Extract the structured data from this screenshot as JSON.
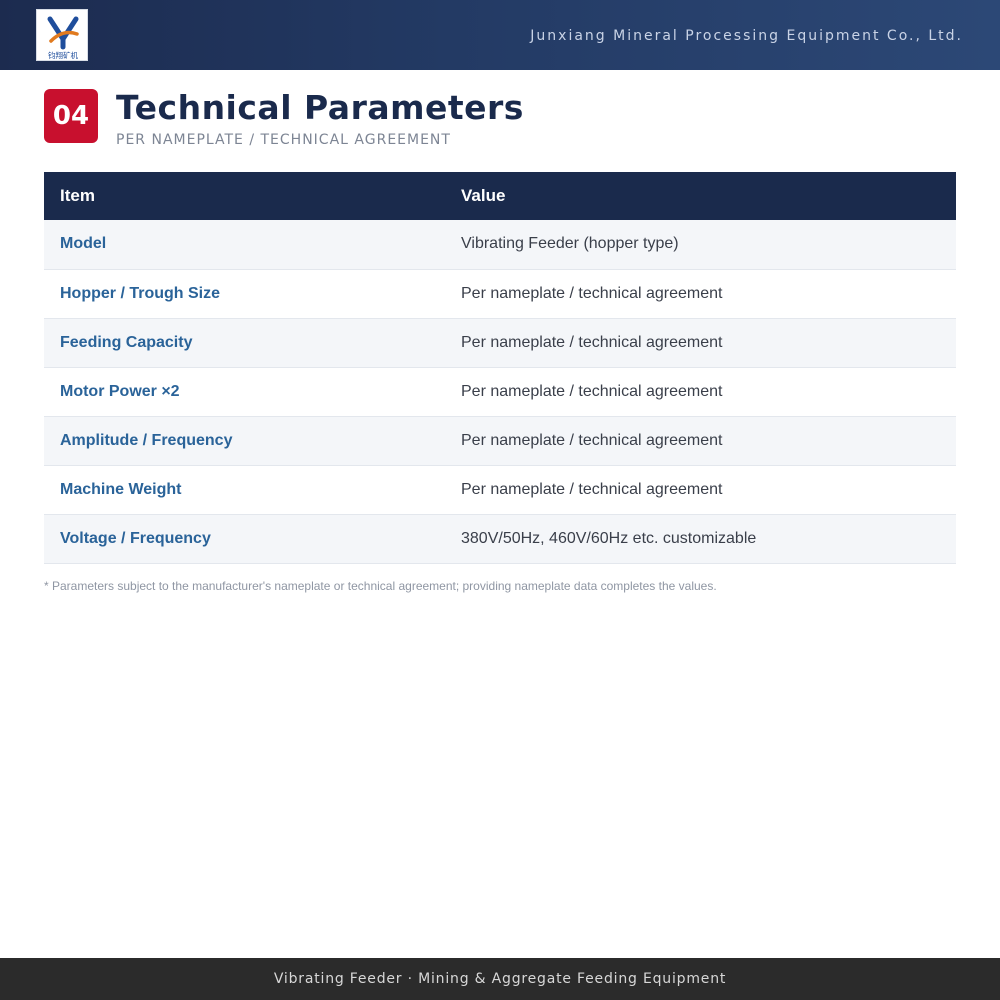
{
  "header": {
    "logo_icon": "company-logo-icon",
    "logo_text": "钧翔矿机",
    "company_name": "Junxiang Mineral Processing Equipment Co., Ltd."
  },
  "section": {
    "number": "04",
    "title": "Technical Parameters",
    "subtitle": "PER NAMEPLATE / TECHNICAL AGREEMENT"
  },
  "table": {
    "columns": [
      "Item",
      "Value"
    ],
    "rows": [
      {
        "item": "Model",
        "value": "Vibrating Feeder (hopper type)"
      },
      {
        "item": "Hopper / Trough Size",
        "value": "Per nameplate / technical agreement"
      },
      {
        "item": "Feeding Capacity",
        "value": "Per nameplate / technical agreement"
      },
      {
        "item": "Motor Power ×2",
        "value": "Per nameplate / technical agreement"
      },
      {
        "item": "Amplitude / Frequency",
        "value": "Per nameplate / technical agreement"
      },
      {
        "item": "Machine Weight",
        "value": "Per nameplate / technical agreement"
      },
      {
        "item": "Voltage / Frequency",
        "value": "380V/50Hz, 460V/60Hz etc. customizable"
      }
    ]
  },
  "note": "* Parameters subject to the manufacturer's nameplate or technical agreement; providing nameplate data completes the values.",
  "footer": {
    "text": "Vibrating Feeder · Mining & Aggregate Feeding Equipment"
  },
  "colors": {
    "header_bg": "#1c2b4f",
    "badge": "#c8102e",
    "title": "#1a2a4c",
    "item_text": "#2a6399",
    "footer_bg": "#2b2b2b"
  }
}
